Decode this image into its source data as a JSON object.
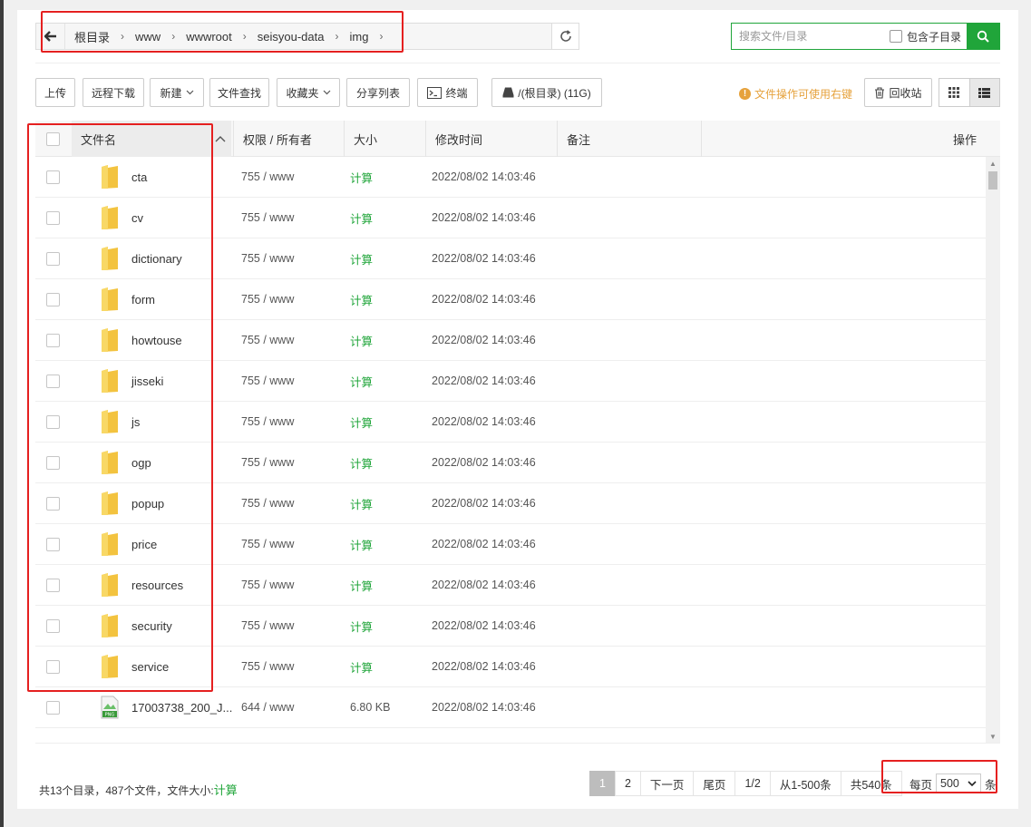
{
  "breadcrumb": [
    "根目录",
    "www",
    "wwwroot",
    "seisyou-data",
    "img"
  ],
  "search": {
    "placeholder": "搜索文件/目录",
    "include_sub": "包含子目录"
  },
  "toolbar": {
    "upload": "上传",
    "remote_download": "远程下载",
    "new": "新建",
    "file_search": "文件查找",
    "favorites": "收藏夹",
    "share_list": "分享列表",
    "terminal": "终端",
    "disk": "/(根目录) (11G)",
    "hint": "文件操作可使用右键",
    "recycle": "回收站"
  },
  "table": {
    "headers": {
      "name": "文件名",
      "perm": "权限 / 所有者",
      "size": "大小",
      "mtime": "修改时间",
      "remark": "备注",
      "ops": "操作"
    },
    "rows": [
      {
        "name": "cta",
        "perm": "755 / www",
        "size": "计算",
        "mtime": "2022/08/02 14:03:46",
        "type": "folder"
      },
      {
        "name": "cv",
        "perm": "755 / www",
        "size": "计算",
        "mtime": "2022/08/02 14:03:46",
        "type": "folder"
      },
      {
        "name": "dictionary",
        "perm": "755 / www",
        "size": "计算",
        "mtime": "2022/08/02 14:03:46",
        "type": "folder"
      },
      {
        "name": "form",
        "perm": "755 / www",
        "size": "计算",
        "mtime": "2022/08/02 14:03:46",
        "type": "folder"
      },
      {
        "name": "howtouse",
        "perm": "755 / www",
        "size": "计算",
        "mtime": "2022/08/02 14:03:46",
        "type": "folder"
      },
      {
        "name": "jisseki",
        "perm": "755 / www",
        "size": "计算",
        "mtime": "2022/08/02 14:03:46",
        "type": "folder"
      },
      {
        "name": "js",
        "perm": "755 / www",
        "size": "计算",
        "mtime": "2022/08/02 14:03:46",
        "type": "folder"
      },
      {
        "name": "ogp",
        "perm": "755 / www",
        "size": "计算",
        "mtime": "2022/08/02 14:03:46",
        "type": "folder"
      },
      {
        "name": "popup",
        "perm": "755 / www",
        "size": "计算",
        "mtime": "2022/08/02 14:03:46",
        "type": "folder"
      },
      {
        "name": "price",
        "perm": "755 / www",
        "size": "计算",
        "mtime": "2022/08/02 14:03:46",
        "type": "folder"
      },
      {
        "name": "resources",
        "perm": "755 / www",
        "size": "计算",
        "mtime": "2022/08/02 14:03:46",
        "type": "folder"
      },
      {
        "name": "security",
        "perm": "755 / www",
        "size": "计算",
        "mtime": "2022/08/02 14:03:46",
        "type": "folder"
      },
      {
        "name": "service",
        "perm": "755 / www",
        "size": "计算",
        "mtime": "2022/08/02 14:03:46",
        "type": "folder"
      },
      {
        "name": "17003738_200_J...",
        "perm": "644 / www",
        "size": "6.80 KB",
        "mtime": "2022/08/02 14:03:46",
        "type": "png"
      }
    ]
  },
  "footer": {
    "summary_prefix": "共13个目录，487个文件，文件大小:",
    "summary_calc": "计算",
    "pages": [
      "1",
      "2",
      "下一页",
      "尾页",
      "1/2",
      "从1-500条",
      "共540条"
    ],
    "per_page_label": "每页",
    "per_page_value": "500",
    "per_page_unit": "条"
  },
  "colors": {
    "accent": "#20a53a",
    "highlight": "#e52020",
    "hint": "#e6a23c",
    "folder": "#f5c842"
  }
}
